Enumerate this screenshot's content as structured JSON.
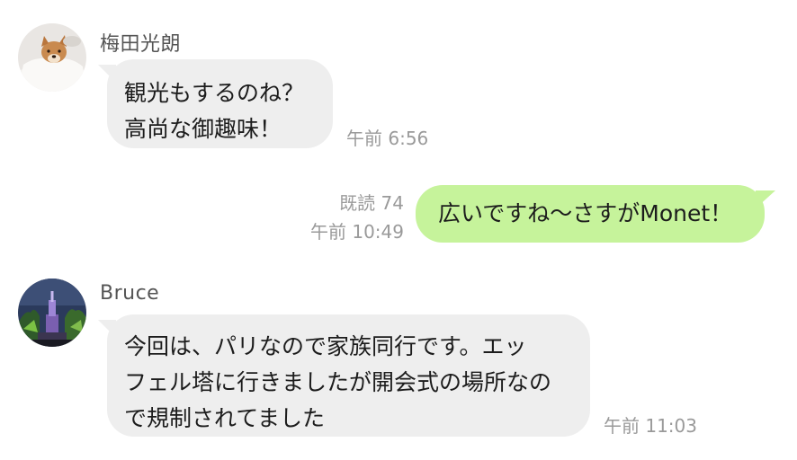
{
  "messages": [
    {
      "sender": "梅田光朗",
      "direction": "incoming",
      "lines": [
        "観光もするのね？",
        "高尚な御趣味！"
      ],
      "time": "午前 6:56"
    },
    {
      "direction": "outgoing",
      "read_label": "既読 74",
      "lines": [
        "広いですね〜さすがMonet！"
      ],
      "time": "午前 10:49"
    },
    {
      "sender": "Bruce",
      "direction": "incoming",
      "lines": [
        "今回は、パリなので家族同行です。エッ",
        "フェル塔に行きましたが開会式の場所なの",
        "で規制されてました"
      ],
      "time": "午前 11:03"
    }
  ],
  "colors": {
    "incoming_bubble": "#eeeeee",
    "outgoing_bubble": "#c6f39b",
    "meta_text": "#9a9a9a"
  },
  "icons": {
    "avatar_1": "shiba-dog-photo",
    "avatar_2": "lit-monument-photo"
  }
}
